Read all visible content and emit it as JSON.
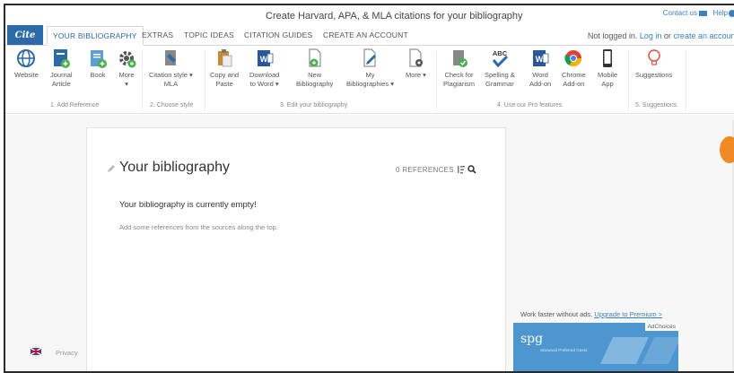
{
  "window": {
    "title": "Create Harvard, APA, & MLA citations for your bibliography"
  },
  "header": {
    "contact_label": "Contact us",
    "help_label": "Help"
  },
  "nav": {
    "logo_text": "Cite",
    "tabs": [
      {
        "label": "YOUR BIBLIOGRAPHY",
        "active": true
      },
      {
        "label": "EXTRAS"
      },
      {
        "label": "TOPIC IDEAS"
      },
      {
        "label": "CITATION GUIDES"
      },
      {
        "label": "CREATE AN ACCOUNT"
      }
    ],
    "login_prefix": "Not logged in. ",
    "login_link": "Log in",
    "login_or": " or ",
    "create_link": "create an account"
  },
  "ribbon": {
    "buttons": [
      {
        "line1": "Website",
        "line2": "",
        "icon": "globe-icon"
      },
      {
        "line1": "Journal",
        "line2": "Article",
        "icon": "journal-icon"
      },
      {
        "line1": "Book",
        "line2": "",
        "icon": "book-icon"
      },
      {
        "line1": "More",
        "line2": "▾",
        "icon": "gear-icon"
      },
      {
        "line1": "Citation style ▾",
        "line2": "MLA",
        "icon": "style-icon"
      },
      {
        "line1": "Copy and",
        "line2": "Paste",
        "icon": "clipboard-icon"
      },
      {
        "line1": "Download",
        "line2": "to Word ▾",
        "icon": "word-download-icon"
      },
      {
        "line1": "New",
        "line2": "Bibliography",
        "icon": "new-document-icon"
      },
      {
        "line1": "My",
        "line2": "Bibliographies ▾",
        "icon": "edit-document-icon"
      },
      {
        "line1": "More ▾",
        "line2": "",
        "icon": "document-settings-icon"
      },
      {
        "line1": "Check for",
        "line2": "Plagiarism",
        "icon": "plagiarism-icon"
      },
      {
        "line1": "Spelling &",
        "line2": "Grammar",
        "icon": "spellcheck-icon"
      },
      {
        "line1": "Word",
        "line2": "Add-on",
        "icon": "word-icon"
      },
      {
        "line1": "Chrome",
        "line2": "Add-on",
        "icon": "chrome-icon"
      },
      {
        "line1": "Mobile",
        "line2": "App",
        "icon": "mobile-icon"
      },
      {
        "line1": "Suggestions",
        "line2": "",
        "icon": "lightbulb-icon"
      }
    ],
    "groups": [
      "1. Add Reference",
      "2. Choose style",
      "3. Edit your bibliography",
      "4. Use our Pro features",
      "5. Suggestions"
    ],
    "spelling_badge": "ABC"
  },
  "main": {
    "title": "Your bibliography",
    "reference_count": "0 REFERENCES",
    "empty_title": "Your bibliography is currently empty!",
    "empty_hint": "Add some references from the sources along the top."
  },
  "footer": {
    "privacy": "Privacy"
  },
  "ad": {
    "upgrade_text": "Work faster without ads. ",
    "upgrade_link": "Upgrade to Premium >",
    "choices_label": "AdChoices",
    "brand": "spg",
    "brand_sub": "Starwood Preferred Guest"
  },
  "colors": {
    "brand": "#2c6aa8",
    "link": "#3a7fc1",
    "accent": "#f08a24",
    "ad_bg": "#4d96cf"
  }
}
